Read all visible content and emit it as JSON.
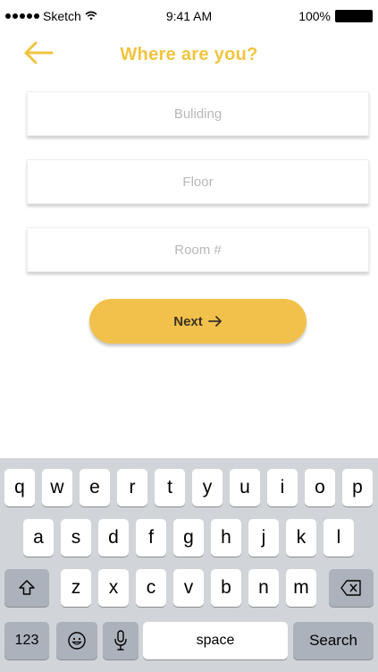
{
  "status_bar": {
    "carrier": "Sketch",
    "time": "9:41 AM",
    "battery": "100%"
  },
  "header": {
    "title": "Where are you?",
    "back_icon": "arrow-left-icon"
  },
  "form": {
    "building_placeholder": "Buliding",
    "floor_placeholder": "Floor",
    "room_placeholder": "Room #"
  },
  "next_button": {
    "label": "Next",
    "icon": "arrow-right-icon"
  },
  "keyboard": {
    "row1": [
      "q",
      "w",
      "e",
      "r",
      "t",
      "y",
      "u",
      "i",
      "o",
      "p"
    ],
    "row2": [
      "a",
      "s",
      "d",
      "f",
      "g",
      "h",
      "j",
      "k",
      "l"
    ],
    "row3": [
      "z",
      "x",
      "c",
      "v",
      "b",
      "n",
      "m"
    ],
    "numbers_label": "123",
    "space_label": "space",
    "search_label": "Search"
  },
  "colors": {
    "accent": "#f2c43f",
    "button": "#f2c14b",
    "keyboard_bg": "#d1d4d9",
    "key_dark": "#acb2bc"
  }
}
